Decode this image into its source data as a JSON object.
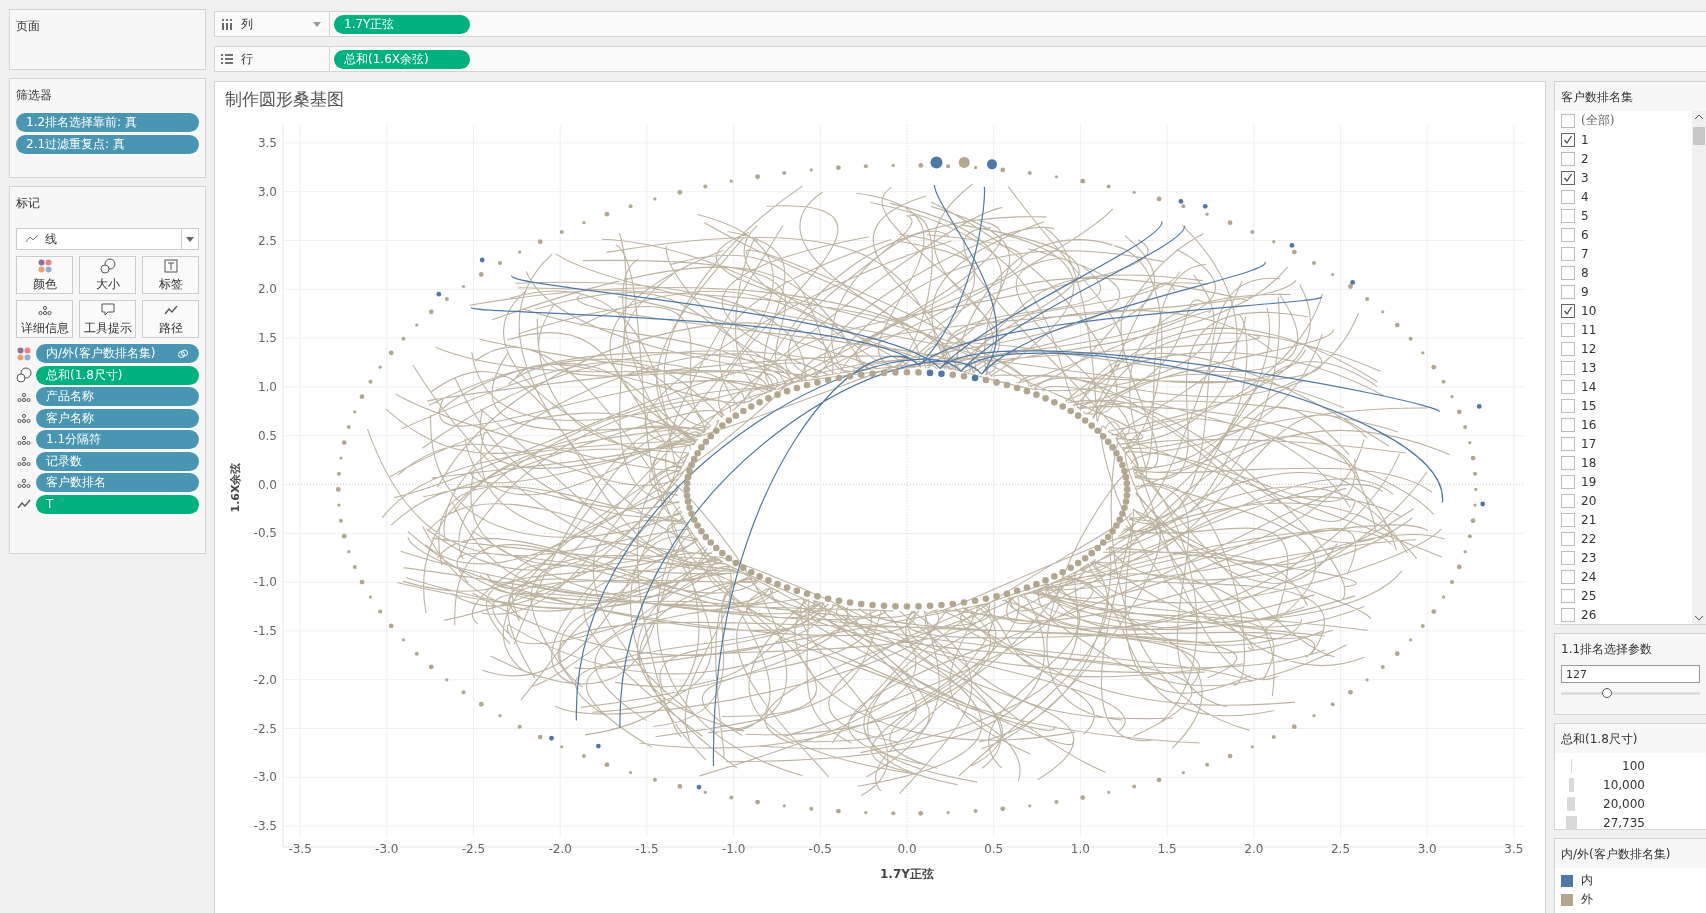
{
  "shelves": [
    {
      "kind": "columns",
      "label": "列",
      "pills": [
        {
          "text": "1.7Y正弦",
          "continuous": true
        }
      ]
    },
    {
      "kind": "rows",
      "label": "行",
      "pills": [
        {
          "text": "总和(1.6X余弦)",
          "continuous": true
        }
      ]
    }
  ],
  "pages_card": {
    "title": "页面"
  },
  "filters_card": {
    "title": "筛选器",
    "pills": [
      {
        "text": "1.2排名选择靠前: 真",
        "continuous": false
      },
      {
        "text": "2.1过滤重复点: 真",
        "continuous": false
      }
    ]
  },
  "marks_card": {
    "title": "标记",
    "mark_type": "线",
    "buttons": [
      {
        "kind": "color",
        "label": "颜色"
      },
      {
        "kind": "size",
        "label": "大小"
      },
      {
        "kind": "label",
        "label": "标签"
      },
      {
        "kind": "detail",
        "label": "详细信息"
      },
      {
        "kind": "tooltip",
        "label": "工具提示"
      },
      {
        "kind": "path",
        "label": "路径"
      }
    ],
    "fields": [
      {
        "kind": "color",
        "text": "内/外(客户数排名集)",
        "continuous": false,
        "linked": true
      },
      {
        "kind": "size",
        "text": "总和(1.8尺寸)",
        "continuous": true,
        "linked": false
      },
      {
        "kind": "detail",
        "text": "产品名称",
        "continuous": false,
        "linked": false
      },
      {
        "kind": "detail",
        "text": "客户名称",
        "continuous": false,
        "linked": false
      },
      {
        "kind": "detail",
        "text": "1.1分隔符",
        "continuous": false,
        "linked": false
      },
      {
        "kind": "detail",
        "text": "记录数",
        "continuous": false,
        "linked": false
      },
      {
        "kind": "detail",
        "text": "客户数排名",
        "continuous": false,
        "linked": false
      },
      {
        "kind": "path",
        "text": "T",
        "continuous": true,
        "linked": false
      }
    ]
  },
  "chart": {
    "title": "制作圆形桑基图",
    "y_title": "1.6X余弦",
    "x_title": "1.7Y正弦",
    "y_ticks": [
      "3.5",
      "3.0",
      "2.5",
      "2.0",
      "1.5",
      "1.0",
      "0.5",
      "0.0",
      "-0.5",
      "-1.0",
      "-1.5",
      "-2.0",
      "-2.5",
      "-3.0",
      "-3.5"
    ],
    "x_ticks": [
      "-3.5",
      "-3.0",
      "-2.5",
      "-2.0",
      "-1.5",
      "-1.0",
      "-0.5",
      "0.0",
      "0.5",
      "1.0",
      "1.5",
      "2.0",
      "2.5",
      "3.0",
      "3.5"
    ]
  },
  "set_filter": {
    "title": "客户数排名集",
    "items": [
      {
        "label": "(全部)",
        "checked": false
      },
      {
        "label": "1",
        "checked": true
      },
      {
        "label": "2",
        "checked": false
      },
      {
        "label": "3",
        "checked": true
      },
      {
        "label": "4",
        "checked": false
      },
      {
        "label": "5",
        "checked": false
      },
      {
        "label": "6",
        "checked": false
      },
      {
        "label": "7",
        "checked": false
      },
      {
        "label": "8",
        "checked": false
      },
      {
        "label": "9",
        "checked": false
      },
      {
        "label": "10",
        "checked": true
      },
      {
        "label": "11",
        "checked": false
      },
      {
        "label": "12",
        "checked": false
      },
      {
        "label": "13",
        "checked": false
      },
      {
        "label": "14",
        "checked": false
      },
      {
        "label": "15",
        "checked": false
      },
      {
        "label": "16",
        "checked": false
      },
      {
        "label": "17",
        "checked": false
      },
      {
        "label": "18",
        "checked": false
      },
      {
        "label": "19",
        "checked": false
      },
      {
        "label": "20",
        "checked": false
      },
      {
        "label": "21",
        "checked": false
      },
      {
        "label": "22",
        "checked": false
      },
      {
        "label": "23",
        "checked": false
      },
      {
        "label": "24",
        "checked": false
      },
      {
        "label": "25",
        "checked": false
      },
      {
        "label": "26",
        "checked": false
      }
    ]
  },
  "parameter": {
    "title": "1.1排名选择参数",
    "value": "127",
    "level": 0.33
  },
  "size_legend": {
    "title": "总和(1.8尺寸)",
    "items": [
      "100",
      "10,000",
      "20,000",
      "27,735"
    ]
  },
  "color_legend": {
    "title": "内/外(客户数排名集)",
    "items": [
      {
        "label": "内",
        "color": "#4e79a7"
      },
      {
        "label": "外",
        "color": "#b2a68f"
      }
    ]
  }
}
